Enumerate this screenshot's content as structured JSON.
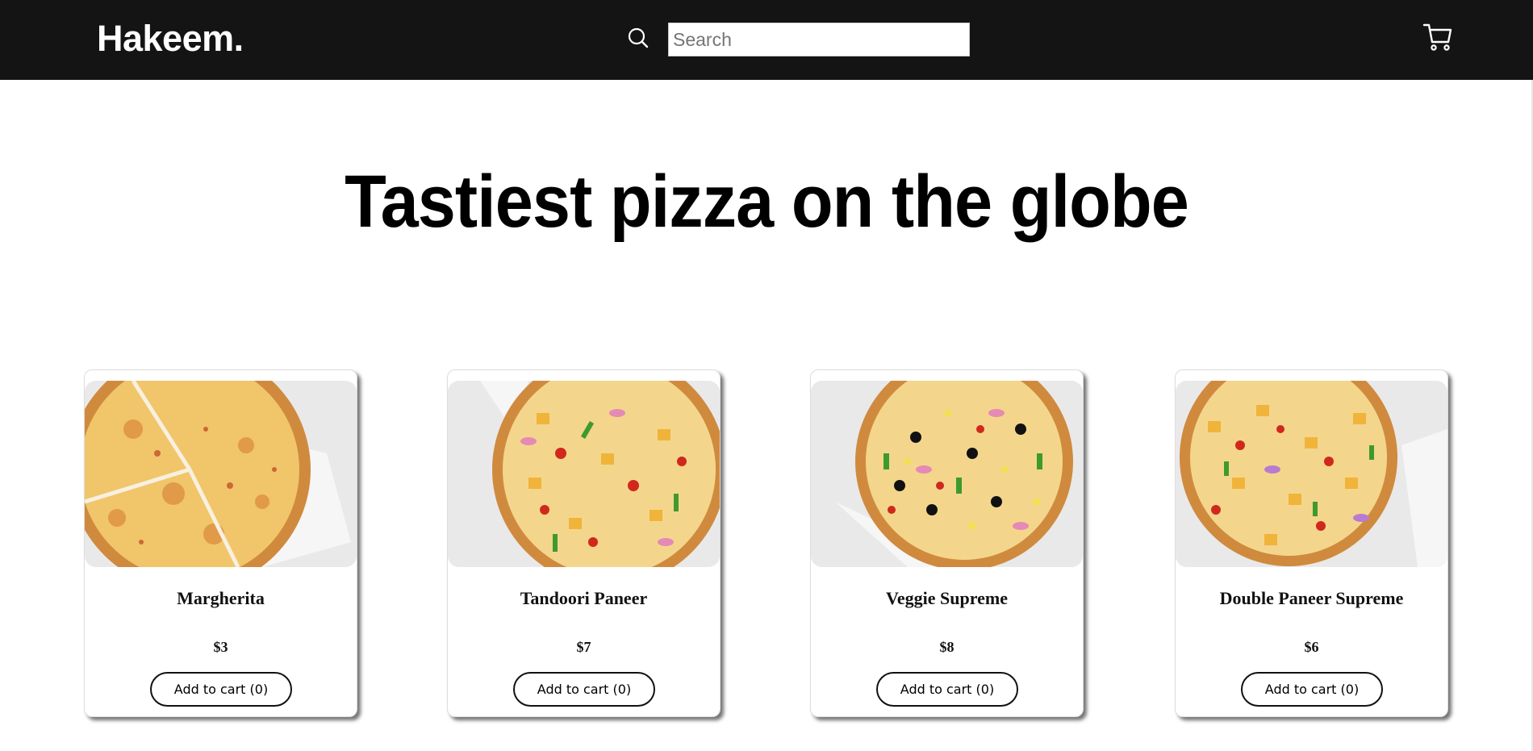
{
  "header": {
    "logo": "Hakeem.",
    "search": {
      "placeholder": "Search",
      "value": ""
    },
    "icons": {
      "search": "search-icon",
      "cart": "cart-icon"
    }
  },
  "hero": {
    "title": "Tastiest pizza on the globe"
  },
  "products": [
    {
      "name": "Margherita",
      "price": "$3",
      "button_label": "Add to cart (0)",
      "cart_count": 0
    },
    {
      "name": "Tandoori Paneer",
      "price": "$7",
      "button_label": "Add to cart (0)",
      "cart_count": 0
    },
    {
      "name": "Veggie Supreme",
      "price": "$8",
      "button_label": "Add to cart (0)",
      "cart_count": 0
    },
    {
      "name": "Double Paneer Supreme",
      "price": "$6",
      "button_label": "Add to cart (0)",
      "cart_count": 0
    }
  ],
  "colors": {
    "navbar_bg": "#141414",
    "logo_text": "#ffffff",
    "page_bg": "#ffffff",
    "crust": "#d08a3e",
    "cheese": "#f1c56a",
    "paper": "#e9e9e9"
  }
}
